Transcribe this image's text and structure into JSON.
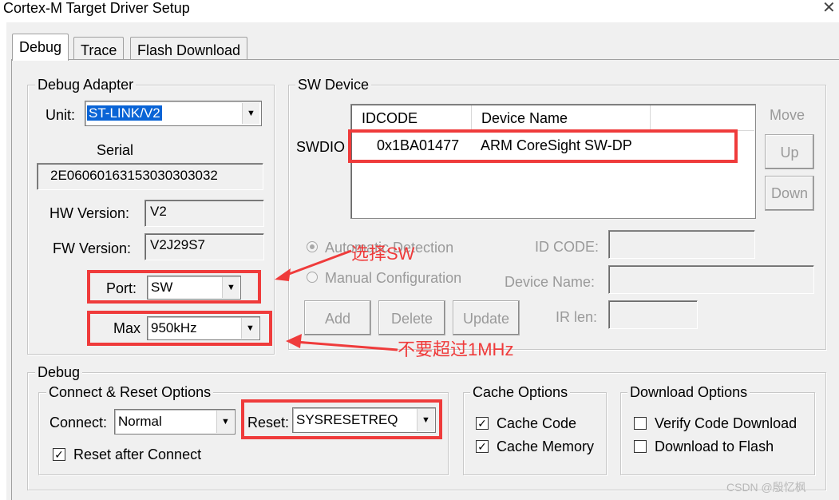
{
  "window": {
    "title": "Cortex-M Target Driver Setup",
    "close_glyph": "✕"
  },
  "tabs": [
    {
      "label": "Debug",
      "active": true
    },
    {
      "label": "Trace",
      "active": false
    },
    {
      "label": "Flash Download",
      "active": false
    }
  ],
  "debug_adapter": {
    "legend": "Debug Adapter",
    "unit_label": "Unit:",
    "unit_value": "ST-LINK/V2",
    "serial_label": "Serial",
    "serial_value": "2E06060163153030303032",
    "hw_label": "HW Version:",
    "hw_value": "V2",
    "fw_label": "FW Version:",
    "fw_value": "V2J29S7",
    "port_label": "Port:",
    "port_value": "SW",
    "max_label": "Max",
    "max_value": "950kHz"
  },
  "sw_device": {
    "legend": "SW Device",
    "columns": [
      "IDCODE",
      "Device Name"
    ],
    "row_label": "SWDIO",
    "rows": [
      {
        "idcode": "0x1BA01477",
        "device_name": "ARM CoreSight SW-DP"
      }
    ],
    "move_label": "Move",
    "up_label": "Up",
    "down_label": "Down",
    "auto_detection_label": "Automatic Detection",
    "manual_config_label": "Manual Configuration",
    "id_code_label": "ID CODE:",
    "device_name_label": "Device Name:",
    "ir_len_label": "IR len:",
    "add_label": "Add",
    "delete_label": "Delete",
    "update_label": "Update",
    "selected_mode": "auto"
  },
  "debug": {
    "legend": "Debug",
    "connect_reset": {
      "legend": "Connect & Reset Options",
      "connect_label": "Connect:",
      "connect_value": "Normal",
      "reset_label": "Reset:",
      "reset_value": "SYSRESETREQ",
      "reset_after_connect_label": "Reset after Connect",
      "reset_after_connect_checked": true
    },
    "cache": {
      "legend": "Cache Options",
      "cache_code_label": "Cache Code",
      "cache_code_checked": true,
      "cache_memory_label": "Cache Memory",
      "cache_memory_checked": true
    },
    "download": {
      "legend": "Download Options",
      "verify_label": "Verify Code Download",
      "verify_checked": false,
      "download_flash_label": "Download to Flash",
      "download_flash_checked": false
    }
  },
  "annotations": {
    "select_sw": "选择SW",
    "not_exceed": "不要超过1MHz",
    "color": "#ef3b3b"
  },
  "watermark": "CSDN @殷忆枫"
}
